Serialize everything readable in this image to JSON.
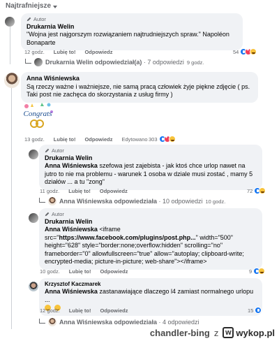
{
  "sort_label": "Najtrafniejsze",
  "author_badge": "Autor",
  "actions": {
    "like": "Lubię to!",
    "reply": "Odpowiedz"
  },
  "comment1": {
    "name": "Drukarnia Welin",
    "text": "\"Wojna jest najgorszym rozwiązaniem najtrudniejszych spraw.\" Napoléon Bonaparte",
    "time": "12 godz.",
    "reactions": "54",
    "replies_name": "Drukarnia Welin odpowiedział(a)",
    "replies_rest": " · 7 odpowiedzi",
    "replies_time": "9 godz."
  },
  "comment2": {
    "name": "Anna Wiśniewska",
    "text": "Są rzeczy ważne i ważniejsze, nie samą pracą człowiek żyje piękne zdjęcie ( ps. Taki post nie zachęca do skorzystania z usług firmy )",
    "time": "13 godz.",
    "edited": "Edytowano",
    "reactions": "303",
    "sticker_text": "Congrats"
  },
  "reply1": {
    "name": "Drukarnia Welin",
    "mention": "Anna Wiśniewska",
    "text": " szefowa jest zajebista - jak ktoś chce urlop nawet na jutro to nie ma problemu - warunek 1 osoba w dziale musi zostać , mamy 5 działów ... a tu \"zong\"",
    "time": "11 godz.",
    "reactions": "72",
    "replies_name": "Anna Wiśniewska odpowiedziała",
    "replies_rest": " · 10 odpowiedzi",
    "replies_time": "10 godz."
  },
  "reply2": {
    "name": "Drukarnia Welin",
    "mention": "Anna Wiśniewska",
    "text_a": " <iframe src=\"",
    "url": "https://www.facebook.com/plugins/post.php...",
    "text_b": "\" width=\"500\" height=\"628\" style=\"border:none;overflow:hidden\" scrolling=\"no\" frameborder=\"0\" allowfullscreen=\"true\" allow=\"autoplay; clipboard-write; encrypted-media; picture-in-picture; web-share\"></iframe>",
    "time": "10 godz.",
    "reactions": "9"
  },
  "reply3": {
    "name": "Krzysztof Kaczmarek",
    "mention": "Anna Wiśniewska",
    "text": " zastanawiające dlaczego l4 zamiast normalnego urlopu ...",
    "time": "12 godz.",
    "reactions": "15",
    "replies_name": "Anna Wiśniewska odpowiedziała",
    "replies_rest": " · 4 odpowiedzi"
  },
  "watermark": {
    "user": "chandler-bing",
    "sep": "z",
    "site": "wykop.pl"
  },
  "colors": {
    "like_blue": "#1877f2",
    "bubble": "#f0f2f5",
    "muted": "#65676b"
  }
}
